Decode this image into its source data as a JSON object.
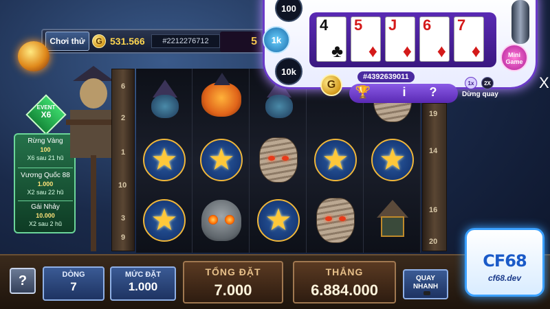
{
  "header": {
    "play_label": "Chơi thử",
    "coin_symbol": "G",
    "balance": "531.566",
    "user_id": "#2212276712",
    "jackpot_partial": "5"
  },
  "event_badge": {
    "line1": "EVENT",
    "line2": "X6"
  },
  "jackpots": [
    {
      "name": "Rừng Vàng",
      "amount": "100",
      "info": "X6 sau 21 hũ"
    },
    {
      "name": "Vương Quốc 88",
      "amount": "1.000",
      "info": "X2 sau 22 hũ"
    },
    {
      "name": "Gái Nhảy",
      "amount": "10.000",
      "info": "X2 sau 2 hũ"
    }
  ],
  "line_numbers_left": [
    "6",
    "2",
    "1",
    "10",
    "3",
    "9"
  ],
  "line_numbers_right": [
    "19",
    "14",
    "16",
    "20"
  ],
  "reels": [
    [
      "witch",
      "star",
      "star"
    ],
    [
      "pumpkin",
      "star",
      "skull"
    ],
    [
      "witch",
      "mummy",
      "star"
    ],
    [
      "blank",
      "star",
      "mummy"
    ],
    [
      "mummy",
      "star",
      "house"
    ]
  ],
  "footer": {
    "help_label": "?",
    "lines_label": "DÒNG",
    "lines_value": "7",
    "bet_label": "MỨC ĐẶT",
    "bet_value": "1.000",
    "total_bet_label": "TỔNG ĐẶT",
    "total_bet_value": "7.000",
    "win_label": "THẮNG",
    "win_value": "6.884.000",
    "quick_spin_label": "QUAY NHANH"
  },
  "mini_game": {
    "chips": [
      "100",
      "1k",
      "10k"
    ],
    "cards": [
      {
        "rank": "4",
        "suit": "♣",
        "color": "black"
      },
      {
        "rank": "5",
        "suit": "♦",
        "color": "red"
      },
      {
        "rank": "J",
        "suit": "♦",
        "color": "red"
      },
      {
        "rank": "6",
        "suit": "♦",
        "color": "red"
      },
      {
        "rank": "7",
        "suit": "♦",
        "color": "red"
      }
    ],
    "session_id": "#4392639011",
    "coin_symbol": "G",
    "icons": [
      "trophy-icon",
      "info-icon",
      "help-icon"
    ],
    "icon_glyphs": [
      "🏆",
      "i",
      "?"
    ],
    "mini_game_label": "Mini Game",
    "speed_1x": "1x",
    "speed_2x": "2X",
    "stop_spin_label": "Dừng quay",
    "close_label": "X"
  },
  "logo": {
    "main": "CF68",
    "sub": "cf68.dev"
  }
}
